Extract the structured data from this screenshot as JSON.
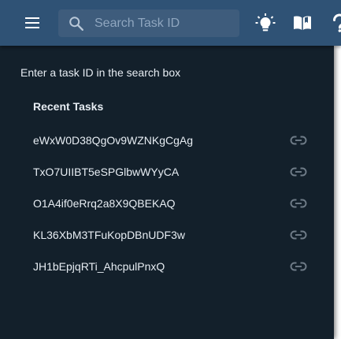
{
  "header": {
    "search": {
      "placeholder": "Search Task ID",
      "value": ""
    },
    "icons": {
      "menu": "hamburger-menu-icon",
      "theme": "lightbulb-icon",
      "docs": "open-book-icon",
      "help": "help-icon"
    }
  },
  "panel": {
    "instructions": "Enter a task ID in the search box",
    "recent_title": "Recent Tasks",
    "tasks": [
      {
        "id": "eWxW0D38QgOv9WZNKgCgAg"
      },
      {
        "id": "TxO7UIIBT5eSPGlbwWYyCA"
      },
      {
        "id": "O1A4if0eRrq2a8X9QBEKAQ"
      },
      {
        "id": "KL36XbM3TFuKopDBnUDF3w"
      },
      {
        "id": "JH1bEpjqRTi_AhcpulPnxQ"
      }
    ]
  },
  "colors": {
    "header_bg": "#2f5275",
    "search_bg": "#3e5c7c",
    "panel_bg": "#13202b",
    "text": "#e7edf3",
    "icon_muted": "#6f7c88"
  }
}
